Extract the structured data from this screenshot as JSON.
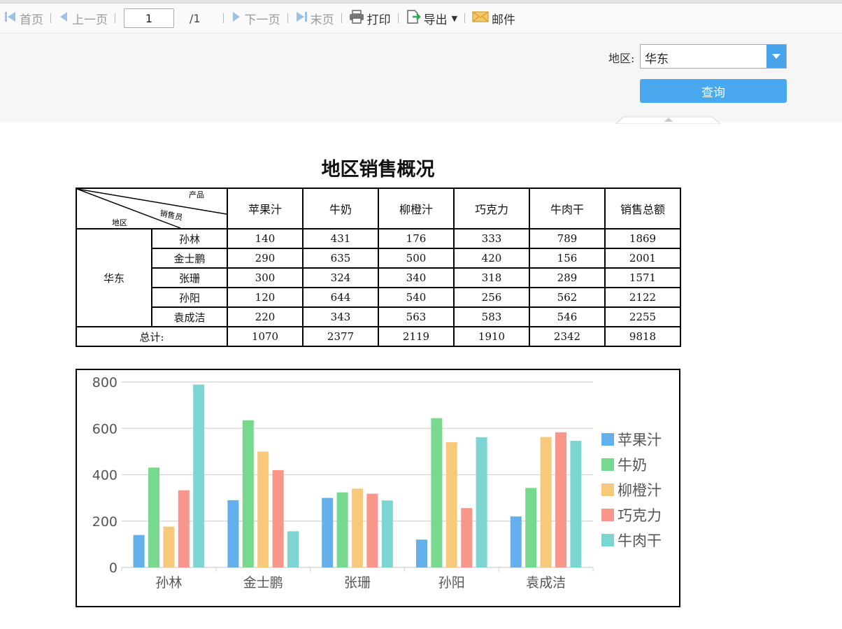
{
  "toolbar": {
    "first": "首页",
    "prev": "上一页",
    "page_value": "1",
    "total": "/1",
    "next": "下一页",
    "last": "末页",
    "print": "打印",
    "export": "导出",
    "mail": "邮件"
  },
  "params": {
    "region_label": "地区:",
    "region_value": "华东",
    "query_button": "查询"
  },
  "report": {
    "title": "地区销售概况",
    "corner_product": "产品",
    "corner_sales": "销售员",
    "corner_region": "地区",
    "columns": [
      "苹果汁",
      "牛奶",
      "柳橙汁",
      "巧克力",
      "牛肉干",
      "销售总额"
    ],
    "region": "华东",
    "rows": [
      {
        "name": "孙林",
        "values": [
          "140",
          "431",
          "176",
          "333",
          "789",
          "1869"
        ]
      },
      {
        "name": "金士鹏",
        "values": [
          "290",
          "635",
          "500",
          "420",
          "156",
          "2001"
        ]
      },
      {
        "name": "张珊",
        "values": [
          "300",
          "324",
          "340",
          "318",
          "289",
          "1571"
        ]
      },
      {
        "name": "孙阳",
        "values": [
          "120",
          "644",
          "540",
          "256",
          "562",
          "2122"
        ]
      },
      {
        "name": "袁成洁",
        "values": [
          "220",
          "343",
          "563",
          "583",
          "546",
          "2255"
        ]
      }
    ],
    "total_label": "总计:",
    "totals": [
      "1070",
      "2377",
      "2119",
      "1910",
      "2342",
      "9818"
    ]
  },
  "chart_data": {
    "type": "bar",
    "categories": [
      "孙林",
      "金士鹏",
      "张珊",
      "孙阳",
      "袁成洁"
    ],
    "series": [
      {
        "name": "苹果汁",
        "color": "#63b0ec",
        "values": [
          140,
          290,
          300,
          120,
          220
        ]
      },
      {
        "name": "牛奶",
        "color": "#77d98d",
        "values": [
          431,
          635,
          324,
          644,
          343
        ]
      },
      {
        "name": "柳橙汁",
        "color": "#f8c97a",
        "values": [
          176,
          500,
          340,
          540,
          563
        ]
      },
      {
        "name": "巧克力",
        "color": "#f79689",
        "values": [
          333,
          420,
          318,
          256,
          583
        ]
      },
      {
        "name": "牛肉干",
        "color": "#7dd5d2",
        "values": [
          789,
          156,
          289,
          562,
          546
        ]
      }
    ],
    "ylim": [
      0,
      800
    ],
    "yticks": [
      0,
      200,
      400,
      600,
      800
    ],
    "grid": true,
    "legend_position": "right"
  }
}
